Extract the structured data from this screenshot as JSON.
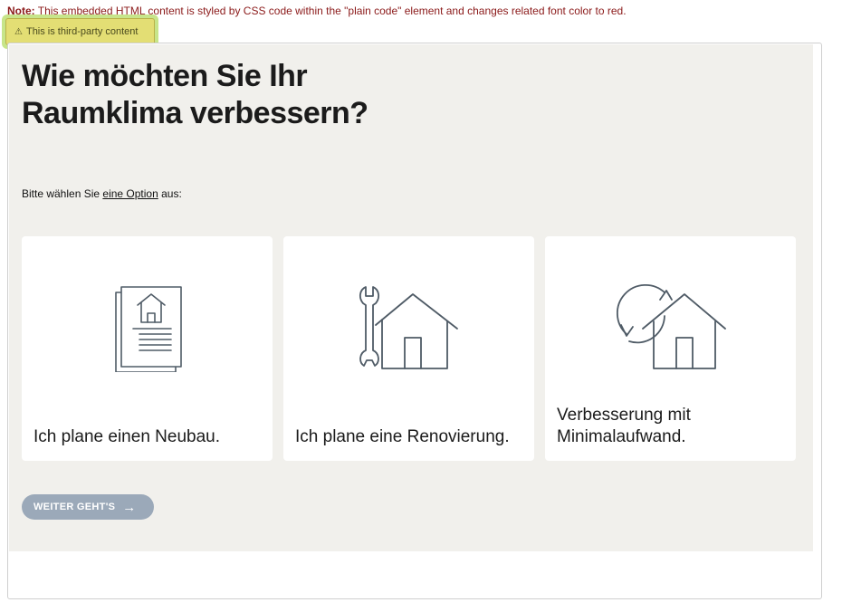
{
  "note": {
    "prefix": "Note:",
    "text": " This embedded HTML content is styled by CSS code within the \"plain code\" element and changes related font color to red."
  },
  "badge": {
    "icon": "warning-icon",
    "text": "This is third-party content"
  },
  "quiz": {
    "title_line1": "Wie möchten Sie Ihr",
    "title_line2": "Raumklima verbessern?",
    "intro_before": "Bitte wählen Sie ",
    "intro_link": "eine Option",
    "intro_after": " aus:",
    "options": [
      {
        "icon": "house-document-icon",
        "label": "Ich plane einen Neubau."
      },
      {
        "icon": "wrench-house-icon",
        "label": "Ich plane eine Renovierung."
      },
      {
        "icon": "refresh-house-icon",
        "label": "Verbesserung mit Minimalaufwand."
      }
    ],
    "next_button": "WEITER GEHT'S",
    "next_arrow": "→"
  },
  "colors": {
    "panel_bg": "#f1f0ec",
    "icon_stroke": "#4f5b66",
    "button_bg": "#9ba9b9",
    "note_text": "#8b1a1a"
  }
}
